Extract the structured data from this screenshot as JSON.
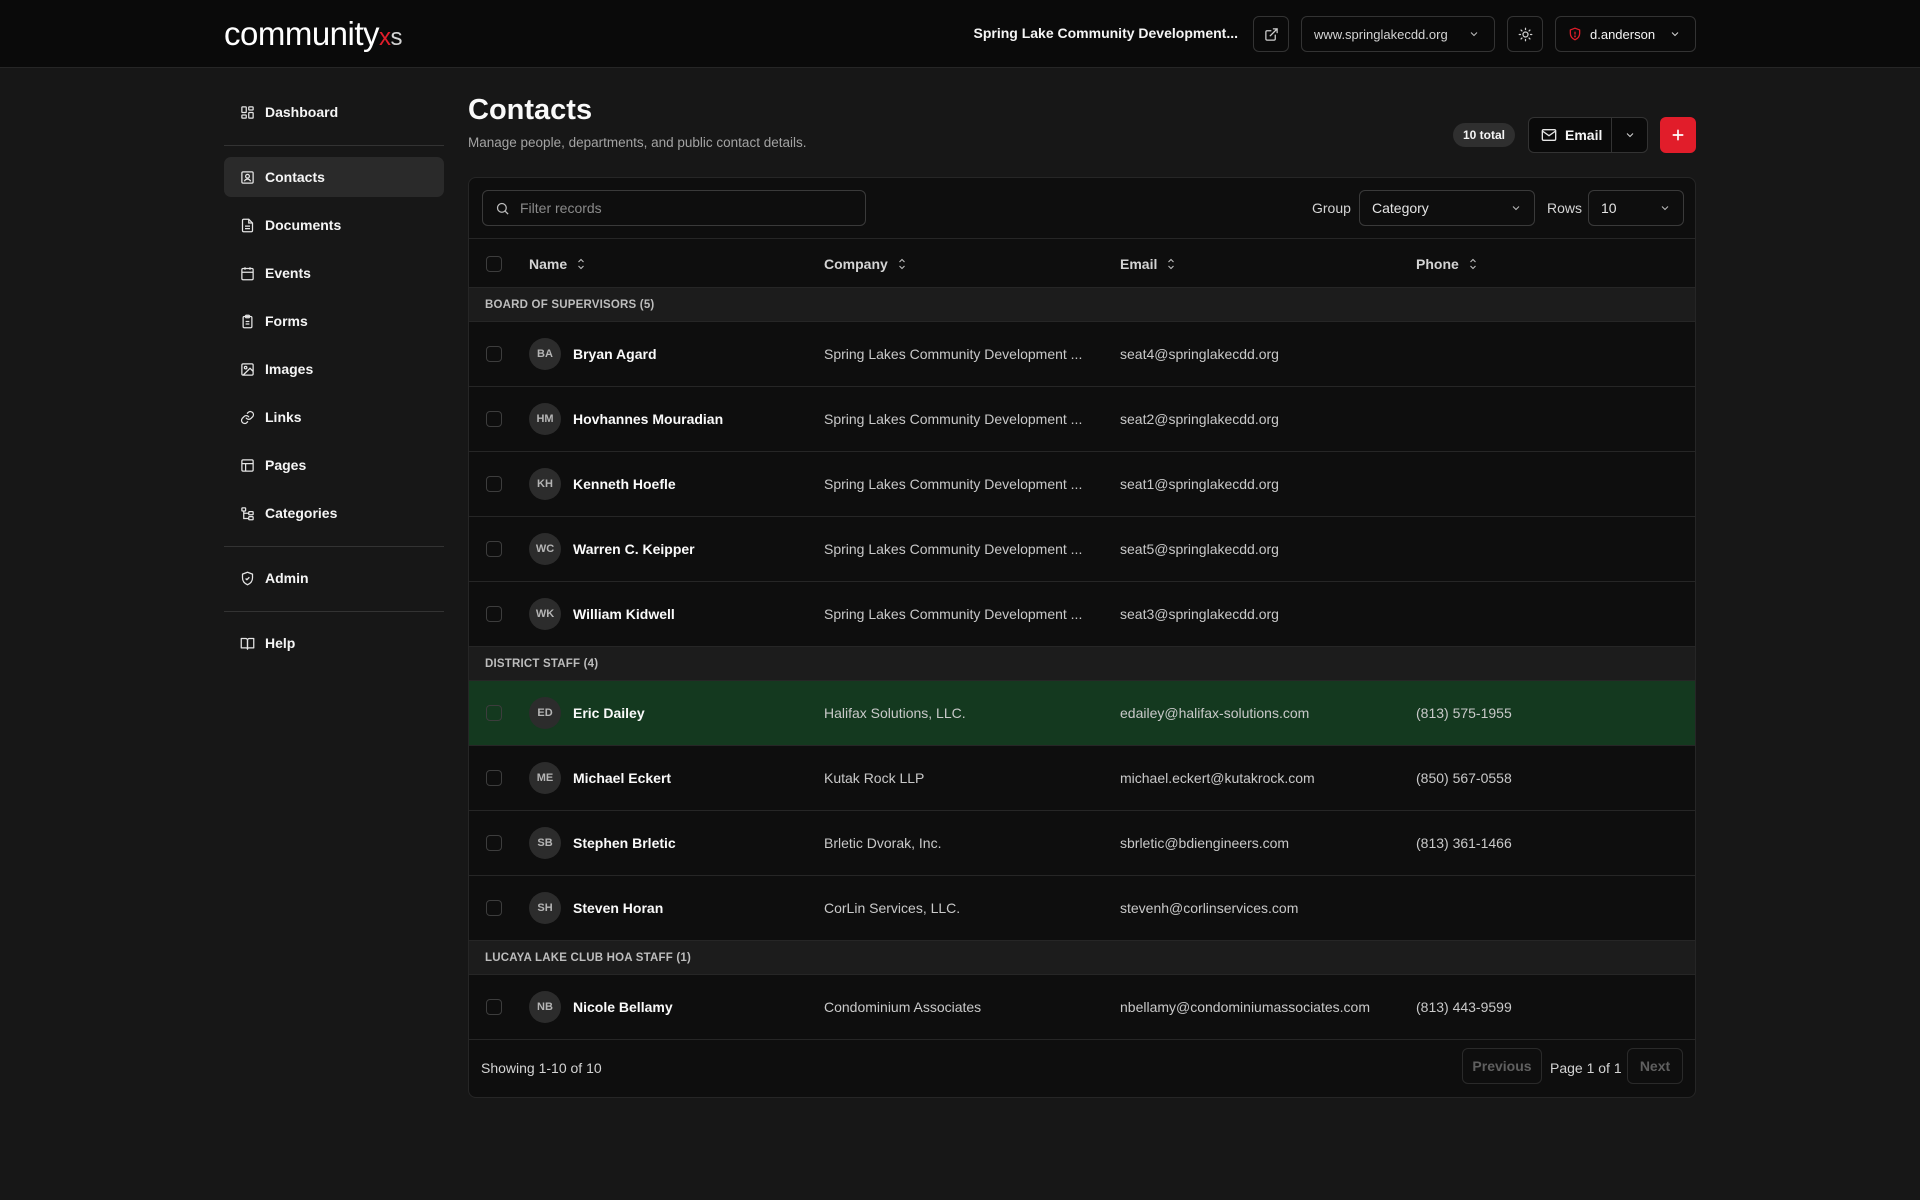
{
  "header": {
    "logo_main": "community",
    "logo_x": "x",
    "logo_s": "s",
    "org_name": "Spring Lake Community Development...",
    "site_select": "www.springlakecdd.org",
    "user": "d.anderson"
  },
  "sidebar": {
    "items": [
      {
        "label": "Dashboard",
        "icon": "grid-icon"
      },
      {
        "label": "Contacts",
        "icon": "contact-card-icon"
      },
      {
        "label": "Documents",
        "icon": "document-icon"
      },
      {
        "label": "Events",
        "icon": "calendar-icon"
      },
      {
        "label": "Forms",
        "icon": "clipboard-icon"
      },
      {
        "label": "Images",
        "icon": "image-icon"
      },
      {
        "label": "Links",
        "icon": "link-icon"
      },
      {
        "label": "Pages",
        "icon": "layout-icon"
      },
      {
        "label": "Categories",
        "icon": "tree-icon"
      },
      {
        "label": "Admin",
        "icon": "shield-icon"
      },
      {
        "label": "Help",
        "icon": "book-icon"
      }
    ]
  },
  "page": {
    "title": "Contacts",
    "subtitle": "Manage people, departments, and public contact details.",
    "total_badge": "10 total",
    "email_button": "Email"
  },
  "toolbar": {
    "filter_placeholder": "Filter records",
    "group_label": "Group",
    "group_value": "Category",
    "rows_label": "Rows",
    "rows_value": "10"
  },
  "table": {
    "columns": [
      "Name",
      "Company",
      "Email",
      "Phone"
    ],
    "groups": [
      {
        "title": "BOARD OF SUPERVISORS (5)",
        "rows": [
          {
            "initials": "BA",
            "name": "Bryan Agard",
            "company": "Spring Lakes Community Development ...",
            "email": "seat4@springlakecdd.org",
            "phone": ""
          },
          {
            "initials": "HM",
            "name": "Hovhannes Mouradian",
            "company": "Spring Lakes Community Development ...",
            "email": "seat2@springlakecdd.org",
            "phone": ""
          },
          {
            "initials": "KH",
            "name": "Kenneth Hoefle",
            "company": "Spring Lakes Community Development ...",
            "email": "seat1@springlakecdd.org",
            "phone": ""
          },
          {
            "initials": "WC",
            "name": "Warren C. Keipper",
            "company": "Spring Lakes Community Development ...",
            "email": "seat5@springlakecdd.org",
            "phone": ""
          },
          {
            "initials": "WK",
            "name": "William Kidwell",
            "company": "Spring Lakes Community Development ...",
            "email": "seat3@springlakecdd.org",
            "phone": ""
          }
        ]
      },
      {
        "title": "DISTRICT STAFF (4)",
        "rows": [
          {
            "initials": "ED",
            "name": "Eric Dailey",
            "company": "Halifax Solutions, LLC.",
            "email": "edailey@halifax-solutions.com",
            "phone": "(813) 575-1955"
          },
          {
            "initials": "ME",
            "name": "Michael Eckert",
            "company": "Kutak Rock LLP",
            "email": "michael.eckert@kutakrock.com",
            "phone": "(850) 567-0558"
          },
          {
            "initials": "SB",
            "name": "Stephen Brletic",
            "company": "Brletic Dvorak, Inc.",
            "email": "sbrletic@bdiengineers.com",
            "phone": "(813) 361-1466"
          },
          {
            "initials": "SH",
            "name": "Steven Horan",
            "company": "CorLin Services, LLC.",
            "email": "stevenh@corlinservices.com",
            "phone": ""
          }
        ]
      },
      {
        "title": "LUCAYA LAKE CLUB HOA STAFF (1)",
        "rows": [
          {
            "initials": "NB",
            "name": "Nicole Bellamy",
            "company": "Condominium Associates",
            "email": "nbellamy@condominiumassociates.com",
            "phone": "(813) 443-9599"
          }
        ]
      }
    ]
  },
  "pagination": {
    "showing": "Showing 1-10 of 10",
    "previous": "Previous",
    "page_info": "Page 1 of 1",
    "next": "Next"
  },
  "colors": {
    "accent": "#e11d2a",
    "highlight_row": "#14391f",
    "background": "#171717"
  }
}
